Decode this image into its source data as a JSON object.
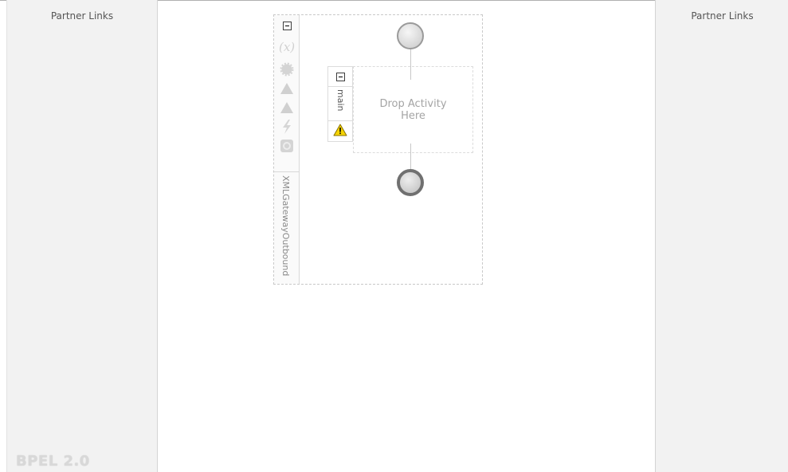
{
  "left_panel": {
    "title": "Partner Links",
    "version_label": "BPEL 2.0"
  },
  "right_panel": {
    "title": "Partner Links"
  },
  "process": {
    "name": "XMLGatewayOutbound",
    "toolbar_icons": [
      "collapse-icon",
      "variables-icon",
      "correlation-icon",
      "fault-handler-icon",
      "compensation-icon",
      "event-handler-icon",
      "termination-icon"
    ],
    "main": {
      "label": "main",
      "drop_text": "Drop Activity Here",
      "status_icon": "warning-icon"
    }
  },
  "colors": {
    "panel_bg": "#f2f2f2",
    "warning": "#f5d300",
    "canvas_bg": "#ffffff"
  }
}
